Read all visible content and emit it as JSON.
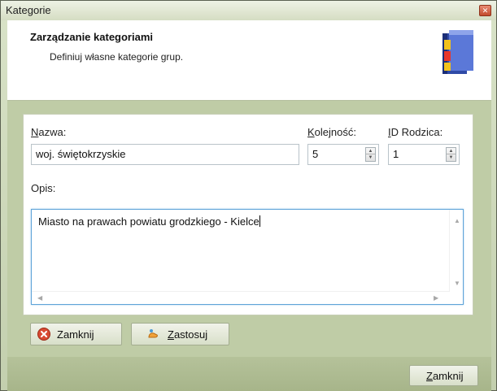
{
  "window": {
    "title": "Kategorie"
  },
  "header": {
    "title": "Zarządzanie kategoriami",
    "subtitle": "Definiuj własne kategorie grup."
  },
  "form": {
    "name_label_first": "N",
    "name_label_rest": "azwa:",
    "name_value": "woj. świętokrzyskie",
    "order_label_first": "K",
    "order_label_rest": "olejność:",
    "order_value": "5",
    "parent_label_first": "I",
    "parent_label_rest": "D Rodzica:",
    "parent_value": "1",
    "desc_label": "Opis:",
    "desc_value": "Miasto na prawach powiatu grodzkiego - Kielce"
  },
  "buttons": {
    "close_inner": "Zamknij",
    "apply_first": "Z",
    "apply_rest": "astosuj",
    "close_footer_first": "Z",
    "close_footer_rest": "amknij"
  },
  "icons": {
    "close": "close-icon",
    "book": "book-icon",
    "close_red": "close-circle-icon",
    "apply": "apply-hand-icon"
  },
  "colors": {
    "accent_blue": "#5fa4d8",
    "header_bg": "#ffffff",
    "content_bg": "#bfcca6",
    "close_red": "#c24a2c"
  }
}
